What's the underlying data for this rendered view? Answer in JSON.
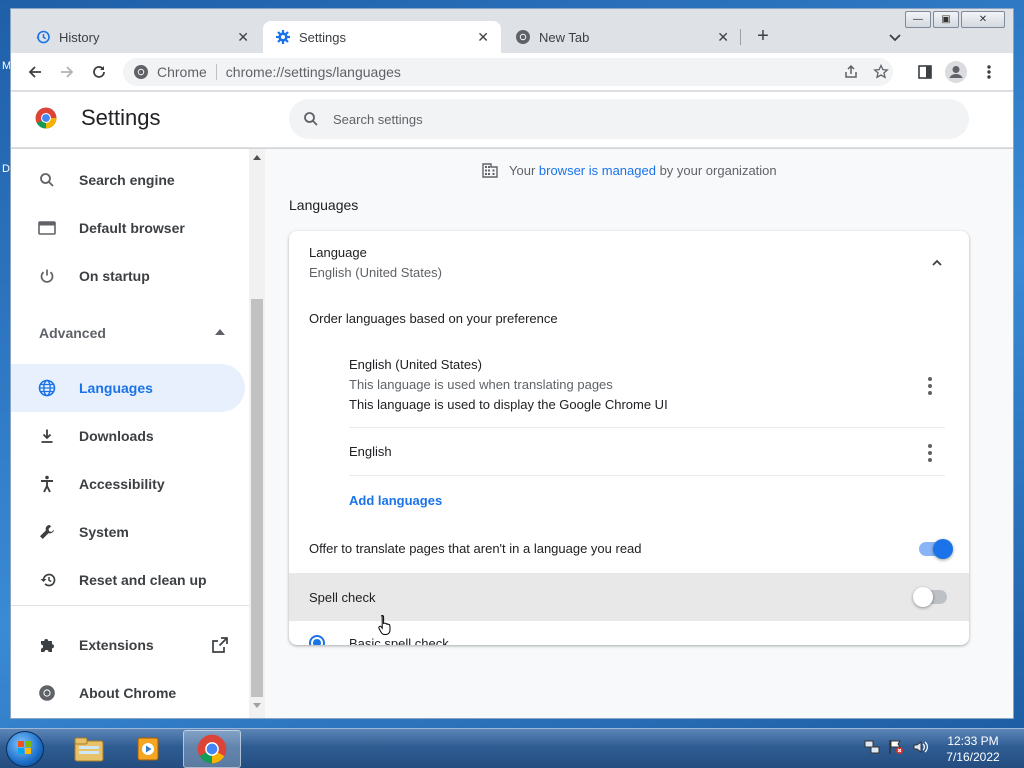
{
  "desktop": {
    "letters": [
      "M",
      "D"
    ]
  },
  "tabs": [
    {
      "title": "History",
      "icon": "history-icon"
    },
    {
      "title": "Settings",
      "icon": "gear-icon"
    },
    {
      "title": "New Tab",
      "icon": "chrome-icon"
    }
  ],
  "toolbar": {
    "site_label": "Chrome",
    "url": "chrome://settings/languages"
  },
  "header": {
    "title": "Settings",
    "search_placeholder": "Search settings"
  },
  "sidebar": {
    "items_top": [
      {
        "label": "Search engine",
        "icon": "search-icon"
      },
      {
        "label": "Default browser",
        "icon": "browser-icon"
      },
      {
        "label": "On startup",
        "icon": "power-icon"
      }
    ],
    "advanced_label": "Advanced",
    "items_advanced": [
      {
        "label": "Languages",
        "icon": "globe-icon",
        "active": true
      },
      {
        "label": "Downloads",
        "icon": "download-icon"
      },
      {
        "label": "Accessibility",
        "icon": "accessibility-icon"
      },
      {
        "label": "System",
        "icon": "wrench-icon"
      },
      {
        "label": "Reset and clean up",
        "icon": "reset-icon"
      }
    ],
    "items_bottom": [
      {
        "label": "Extensions",
        "icon": "puzzle-icon"
      },
      {
        "label": "About Chrome",
        "icon": "chrome-icon"
      }
    ]
  },
  "main": {
    "managed": {
      "prefix": "Your ",
      "link": "browser is managed",
      "suffix": " by your organization"
    },
    "section_title": "Languages",
    "language": {
      "label": "Language",
      "value": "English (United States)",
      "order_label": "Order languages based on your preference",
      "entries": [
        {
          "name": "English (United States)",
          "note1": "This language is used when translating pages",
          "note2": "This language is used to display the Google Chrome UI"
        },
        {
          "name": "English"
        }
      ],
      "add_label": "Add languages"
    },
    "translate_label": "Offer to translate pages that aren't in a language you read",
    "translate_on": true,
    "spell_label": "Spell check",
    "spell_on": false,
    "basic_spell_label": "Basic spell check"
  },
  "taskbar": {
    "time": "12:33 PM",
    "date": "7/16/2022"
  },
  "colors": {
    "accent": "#1a73e8",
    "active_nav_bg": "#e8f0fe",
    "spell_row_hover": "#e8e8e8"
  }
}
